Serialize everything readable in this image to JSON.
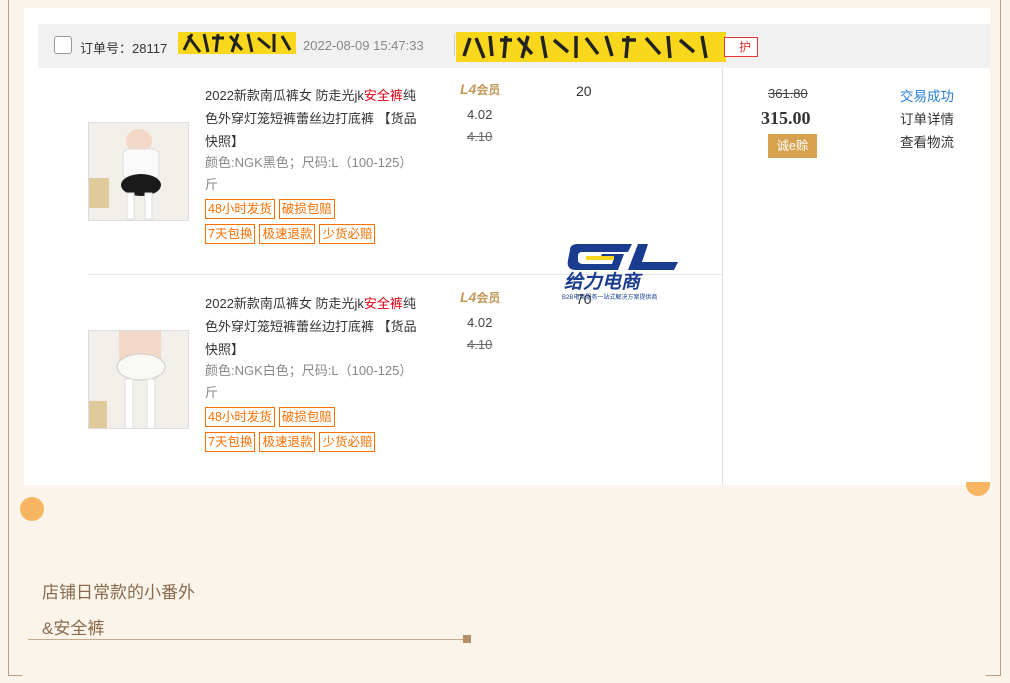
{
  "order": {
    "checkbox_label": "",
    "order_label": "订单号：28117",
    "time": "2022-08-09 15:47:33",
    "tag_text": "护"
  },
  "items": [
    {
      "title_start": "2022新款南瓜裤女 防走光jk",
      "title_red": "安全裤",
      "title_end": "纯色外穿灯笼短裤蕾丝边打底裤 【货品快照】",
      "sku": "颜色:NGK黑色；尺码:L（100-125）斤",
      "badges_row1": [
        "48小时发货",
        "破损包赔"
      ],
      "badges_row2": [
        "7天包换",
        "极速退款",
        "少货必赔"
      ],
      "member_level": "L4",
      "member_text": "会员",
      "unit_price": "4.02",
      "unit_price_old": "4.10",
      "quantity": "20"
    },
    {
      "title_start": "2022新款南瓜裤女 防走光jk",
      "title_red": "安全裤",
      "title_end": "纯色外穿灯笼短裤蕾丝边打底裤 【货品快照】",
      "sku": "颜色:NGK白色；尺码:L（100-125）斤",
      "badges_row1": [
        "48小时发货",
        "破损包赔"
      ],
      "badges_row2": [
        "7天包换",
        "极速退款",
        "少货必赔"
      ],
      "member_level": "L4",
      "member_text": "会员",
      "unit_price": "4.02",
      "unit_price_old": "4.10",
      "quantity": "70"
    }
  ],
  "summary": {
    "price_old": "361.80",
    "price": "315.00",
    "insurance_button": "诚e赊",
    "status": "交易成功",
    "detail_link": "订单详情",
    "logistics_link": "查看物流"
  },
  "watermark": {
    "logo_text": "GL",
    "brand": "给力电商",
    "tagline": "B2B电商服务一站式解决方案提供商"
  },
  "captions": {
    "line1": "店铺日常款的小番外",
    "line2": "&安全裤"
  },
  "colors": {
    "accent_orange": "#ff6f00",
    "gold": "#d7a24f",
    "link_blue": "#2a7fd4",
    "background": "#faf4ea"
  }
}
